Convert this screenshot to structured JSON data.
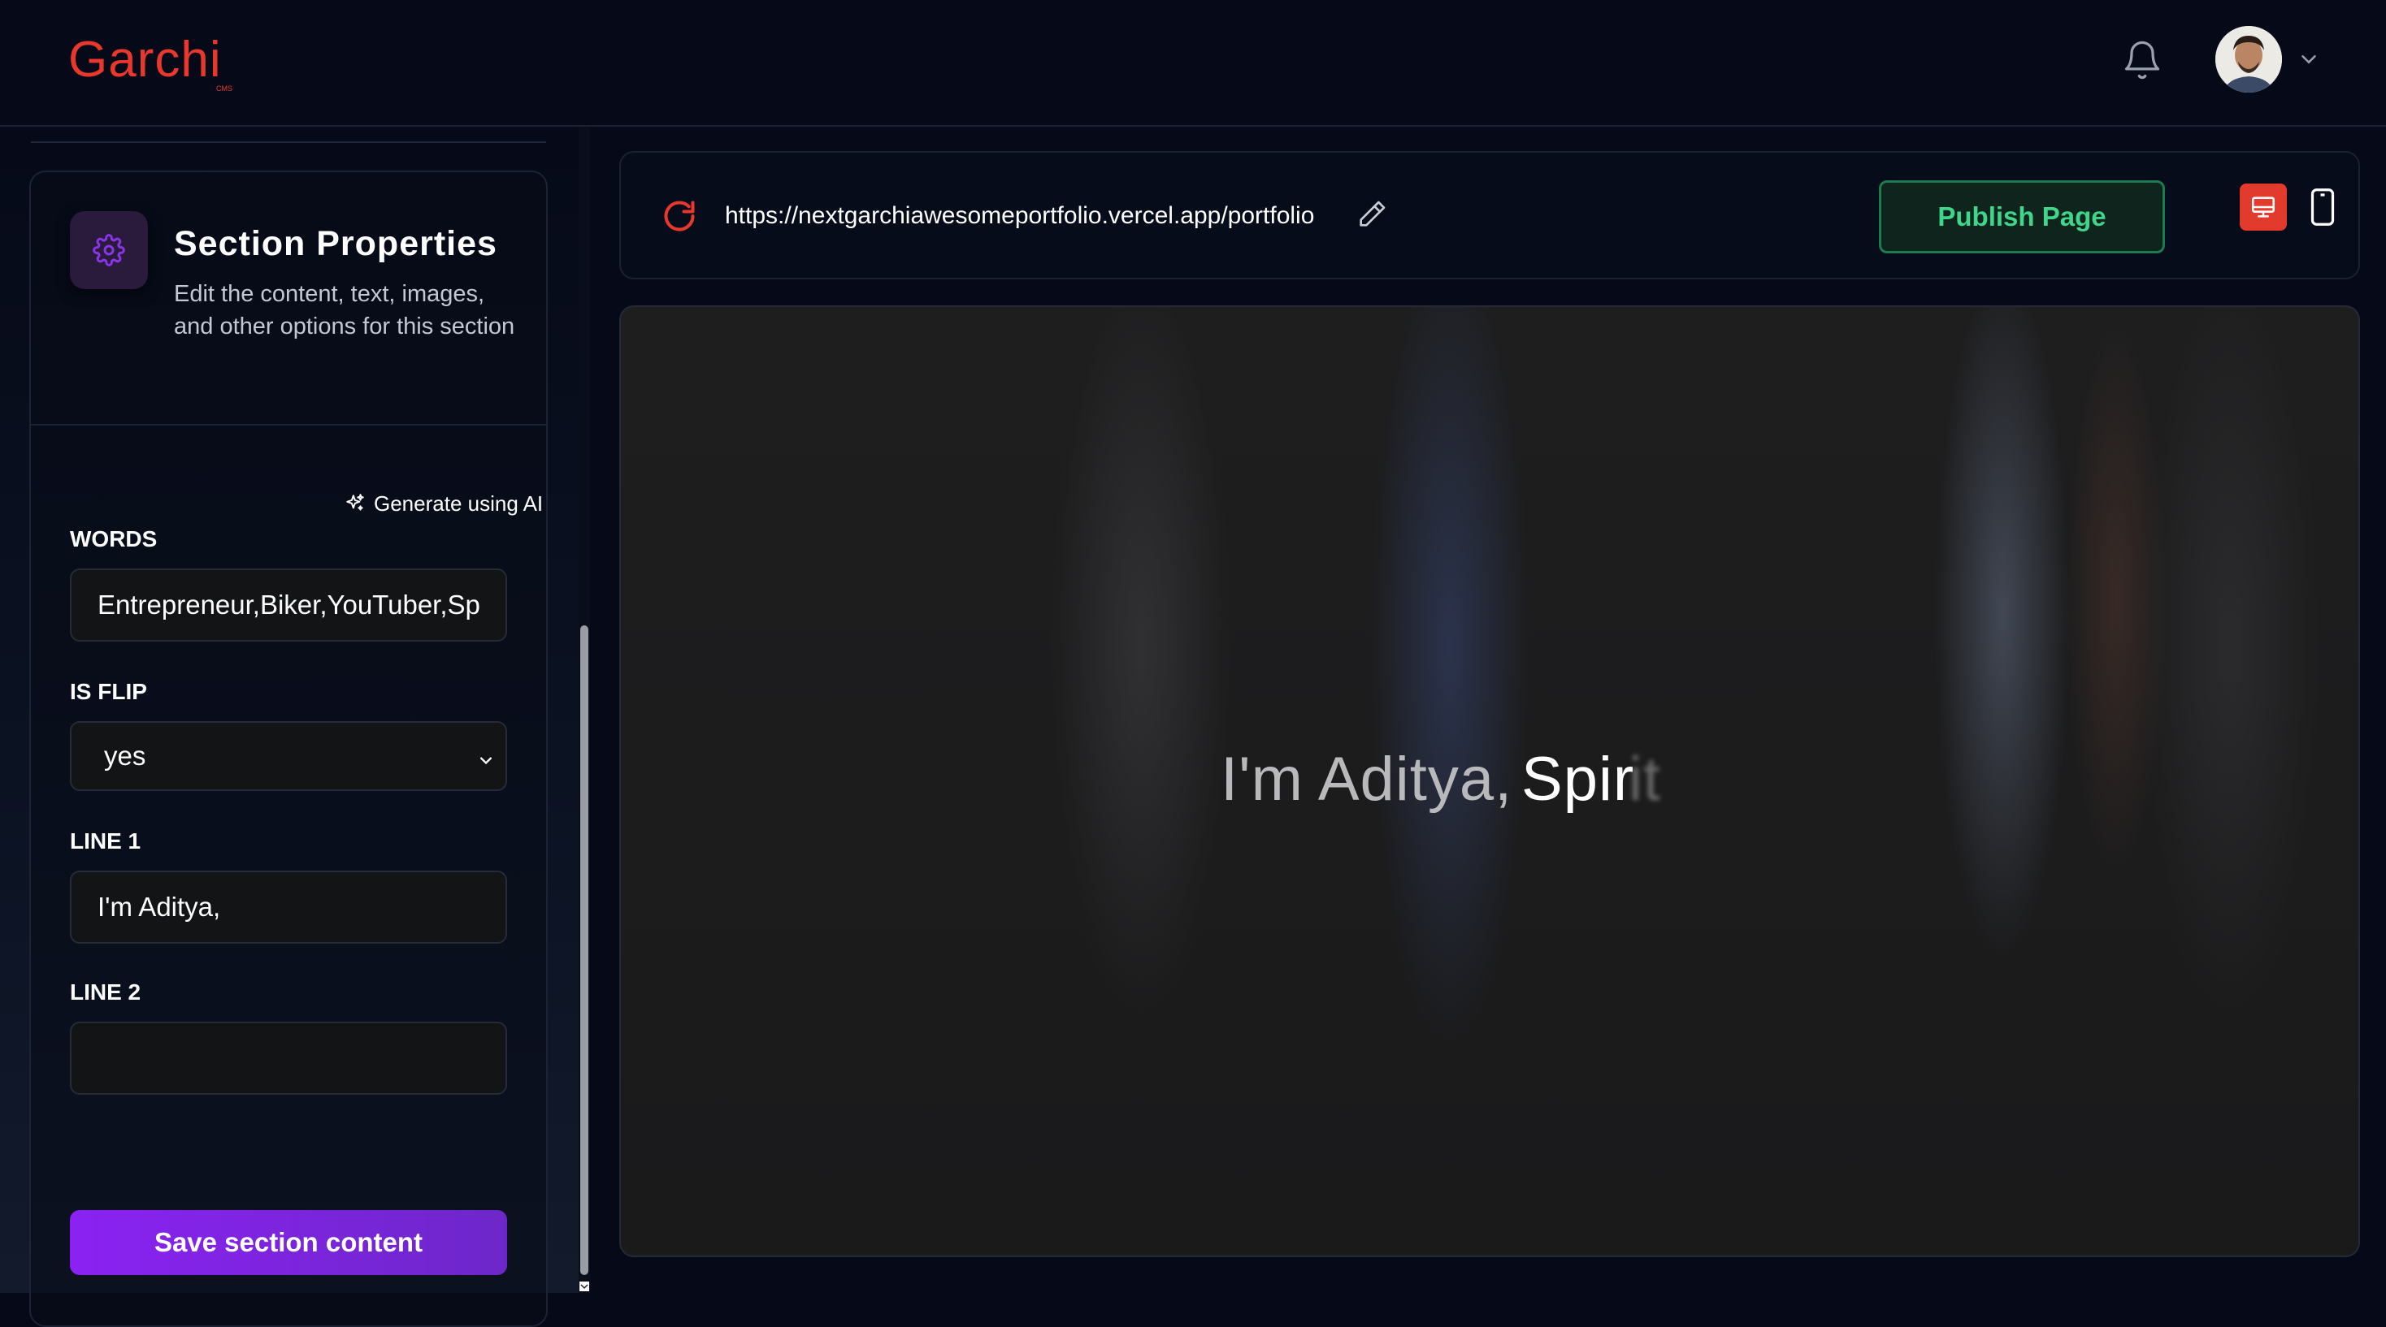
{
  "header": {
    "logo": "Garchi",
    "logo_sub": "CMS",
    "icons": [
      "bell-icon",
      "avatar",
      "chevron-down-icon"
    ]
  },
  "panel": {
    "title": "Section Properties",
    "description": "Edit the content, text, images, and other options for this section",
    "generate_ai": "Generate using AI",
    "fields": {
      "words": {
        "label": "WORDS",
        "value": "Entrepreneur,Biker,YouTuber,Sp"
      },
      "is_flip": {
        "label": "IS FLIP",
        "value": "yes"
      },
      "line1": {
        "label": "LINE 1",
        "value": "I'm Aditya,"
      },
      "line2": {
        "label": "LINE 2",
        "value": ""
      }
    },
    "save_label": "Save section content"
  },
  "toolbar": {
    "url": "https://nextgarchiawesomeportfolio.vercel.app/portfolio",
    "publish_label": "Publish Page",
    "colors": {
      "accent": "#e23a2d",
      "publish": "#3fd68a",
      "save": "#8b22f2"
    }
  },
  "preview": {
    "line1": "I'm Aditya,",
    "word": "Spir",
    "word_fading": "it"
  }
}
